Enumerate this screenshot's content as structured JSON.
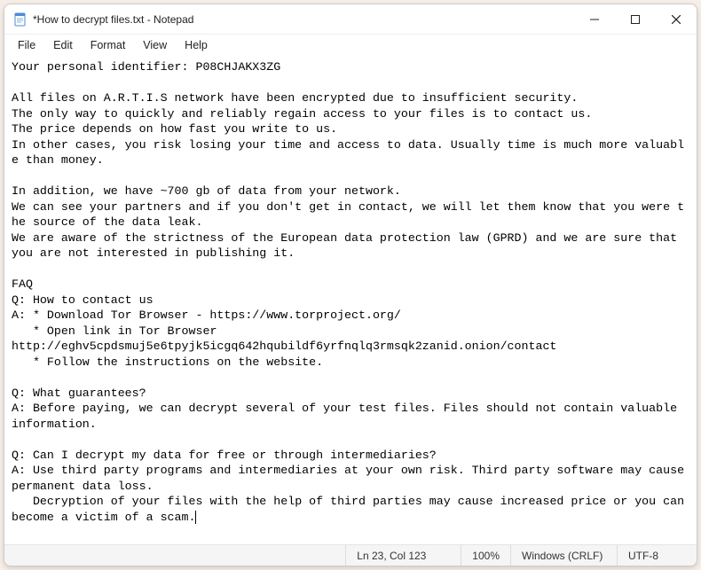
{
  "window": {
    "title": "*How to decrypt files.txt - Notepad"
  },
  "menu": {
    "file": "File",
    "edit": "Edit",
    "format": "Format",
    "view": "View",
    "help": "Help"
  },
  "content": {
    "text": "Your personal identifier: P08CHJAKX3ZG\n\nAll files on A.R.T.I.S network have been encrypted due to insufficient security.\nThe only way to quickly and reliably regain access to your files is to contact us.\nThe price depends on how fast you write to us.\nIn other cases, you risk losing your time and access to data. Usually time is much more valuable than money.\n\nIn addition, we have ~700 gb of data from your network.\nWe can see your partners and if you don't get in contact, we will let them know that you were the source of the data leak.\nWe are aware of the strictness of the European data protection law (GPRD) and we are sure that you are not interested in publishing it.\n\nFAQ\nQ: How to contact us\nA: * Download Tor Browser - https://www.torproject.org/\n   * Open link in Tor Browser\nhttp://eghv5cpdsmuj5e6tpyjk5icgq642hqubildf6yrfnqlq3rmsqk2zanid.onion/contact\n   * Follow the instructions on the website.\n\nQ: What guarantees?\nA: Before paying, we can decrypt several of your test files. Files should not contain valuable information.\n\nQ: Can I decrypt my data for free or through intermediaries?\nA: Use third party programs and intermediaries at your own risk. Third party software may cause permanent data loss.\n   Decryption of your files with the help of third parties may cause increased price or you can become a victim of a scam."
  },
  "status": {
    "lncol": "Ln 23, Col 123",
    "zoom": "100%",
    "eol": "Windows (CRLF)",
    "encoding": "UTF-8"
  }
}
